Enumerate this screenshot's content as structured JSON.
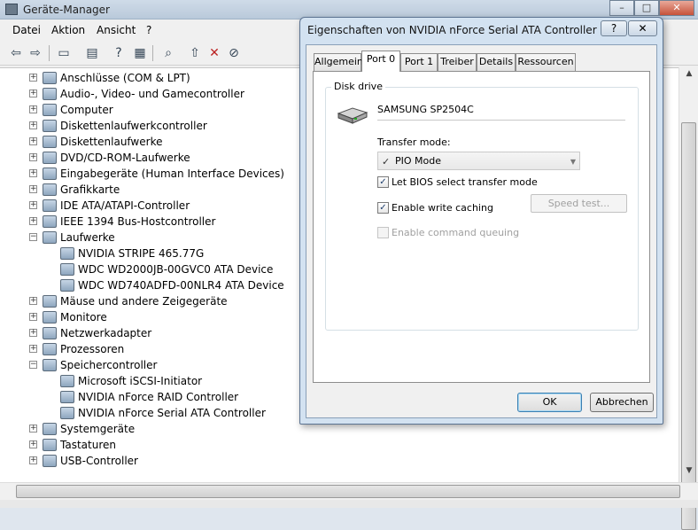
{
  "main": {
    "title": "Geräte-Manager",
    "window_buttons": {
      "minimize": "–",
      "maximize": "□",
      "close": "✕"
    },
    "menu": [
      "Datei",
      "Aktion",
      "Ansicht",
      "?"
    ],
    "toolbar_icons": [
      "back-icon",
      "forward-icon",
      "up-icon",
      "properties-icon",
      "help-icon",
      "view-icon",
      "scan-hardware-icon",
      "update-driver-icon",
      "disable-icon",
      "uninstall-icon"
    ]
  },
  "tree": {
    "nodes": [
      {
        "label": "Anschlüsse (COM & LPT)",
        "level": 0,
        "expander": "+"
      },
      {
        "label": "Audio-, Video- und Gamecontroller",
        "level": 0,
        "expander": "+"
      },
      {
        "label": "Computer",
        "level": 0,
        "expander": "+"
      },
      {
        "label": "Diskettenlaufwerkcontroller",
        "level": 0,
        "expander": "+"
      },
      {
        "label": "Diskettenlaufwerke",
        "level": 0,
        "expander": "+"
      },
      {
        "label": "DVD/CD-ROM-Laufwerke",
        "level": 0,
        "expander": "+"
      },
      {
        "label": "Eingabegeräte (Human Interface Devices)",
        "level": 0,
        "expander": "+"
      },
      {
        "label": "Grafikkarte",
        "level": 0,
        "expander": "+"
      },
      {
        "label": "IDE ATA/ATAPI-Controller",
        "level": 0,
        "expander": "+"
      },
      {
        "label": "IEEE 1394 Bus-Hostcontroller",
        "level": 0,
        "expander": "+"
      },
      {
        "label": "Laufwerke",
        "level": 0,
        "expander": "−"
      },
      {
        "label": "NVIDIA  STRIPE  465.77G",
        "level": 1,
        "expander": ""
      },
      {
        "label": "WDC WD2000JB-00GVC0 ATA Device",
        "level": 1,
        "expander": ""
      },
      {
        "label": "WDC WD740ADFD-00NLR4 ATA Device",
        "level": 1,
        "expander": ""
      },
      {
        "label": "Mäuse und andere Zeigegeräte",
        "level": 0,
        "expander": "+"
      },
      {
        "label": "Monitore",
        "level": 0,
        "expander": "+"
      },
      {
        "label": "Netzwerkadapter",
        "level": 0,
        "expander": "+"
      },
      {
        "label": "Prozessoren",
        "level": 0,
        "expander": "+"
      },
      {
        "label": "Speichercontroller",
        "level": 0,
        "expander": "−"
      },
      {
        "label": "Microsoft iSCSI-Initiator",
        "level": 1,
        "expander": ""
      },
      {
        "label": "NVIDIA nForce RAID Controller",
        "level": 1,
        "expander": ""
      },
      {
        "label": "NVIDIA nForce Serial ATA Controller",
        "level": 1,
        "expander": ""
      },
      {
        "label": "Systemgeräte",
        "level": 0,
        "expander": "+"
      },
      {
        "label": "Tastaturen",
        "level": 0,
        "expander": "+"
      },
      {
        "label": "USB-Controller",
        "level": 0,
        "expander": "+"
      }
    ]
  },
  "dialog": {
    "title": "Eigenschaften von NVIDIA nForce Serial ATA Controller",
    "help": "?",
    "close": "✕",
    "tabs": [
      "Allgemein",
      "Port 0",
      "Port 1",
      "Treiber",
      "Details",
      "Ressourcen"
    ],
    "active_tab": "Port 0",
    "group_label": "Disk drive",
    "device_name": "SAMSUNG SP2504C",
    "transfer_mode_label": "Transfer mode:",
    "transfer_mode_value": "PIO Mode",
    "transfer_mode_check": "✓",
    "dropdown_arrow": "▼",
    "checkboxes": {
      "bios": {
        "label": "Let BIOS select transfer mode",
        "checked": true,
        "mark": "✓"
      },
      "write_cache": {
        "label": "Enable write caching",
        "checked": true,
        "mark": "✓"
      },
      "command_queuing": {
        "label": "Enable command queuing",
        "checked": false,
        "mark": ""
      }
    },
    "speed_test": "Speed test...",
    "ok": "OK",
    "cancel": "Abbrechen"
  },
  "colors": {
    "accent": "#3c7fb1",
    "dialog_frame": "#d3e2f1"
  }
}
